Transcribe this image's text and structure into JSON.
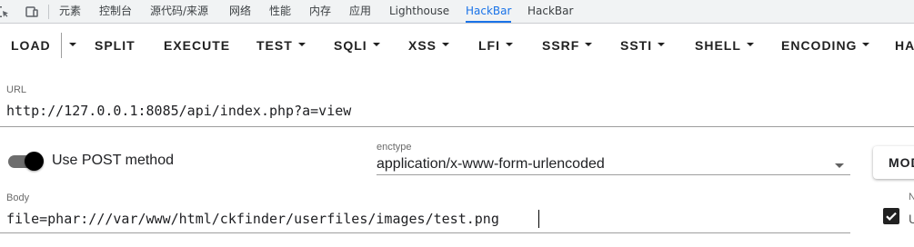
{
  "devtools_tabs": {
    "items": [
      "元素",
      "控制台",
      "源代码/来源",
      "网络",
      "性能",
      "内存",
      "应用",
      "Lighthouse",
      "HackBar",
      "HackBar"
    ],
    "active_index": 8
  },
  "toolbar": {
    "load": "LOAD",
    "split": "SPLIT",
    "execute": "EXECUTE",
    "test": "TEST",
    "sqli": "SQLI",
    "xss": "XSS",
    "lfi": "LFI",
    "ssrf": "SSRF",
    "ssti": "SSTI",
    "shell": "SHELL",
    "encoding": "ENCODING",
    "clipped": "HA"
  },
  "url_field": {
    "label": "URL",
    "value": "http://127.0.0.1:8085/api/index.php?a=view"
  },
  "post_switch": {
    "label": "Use POST method",
    "on": true
  },
  "enctype": {
    "label": "enctype",
    "value": "application/x-www-form-urlencoded"
  },
  "modify_button": {
    "label": "MOD"
  },
  "body_field": {
    "label": "Body",
    "value": "file=phar:///var/www/html/ckfinder/userfiles/images/test.png"
  },
  "right_edge": {
    "clipped_label_top": "N",
    "clipped_label_check": "U",
    "checked": true
  },
  "colors": {
    "active_tab": "#1a73e8",
    "switch_thumb": "#000000",
    "switch_track": "#6d6d6d",
    "underline": "#9e9e9e"
  },
  "icons": [
    "inspect-element-icon",
    "device-toolbar-icon"
  ]
}
